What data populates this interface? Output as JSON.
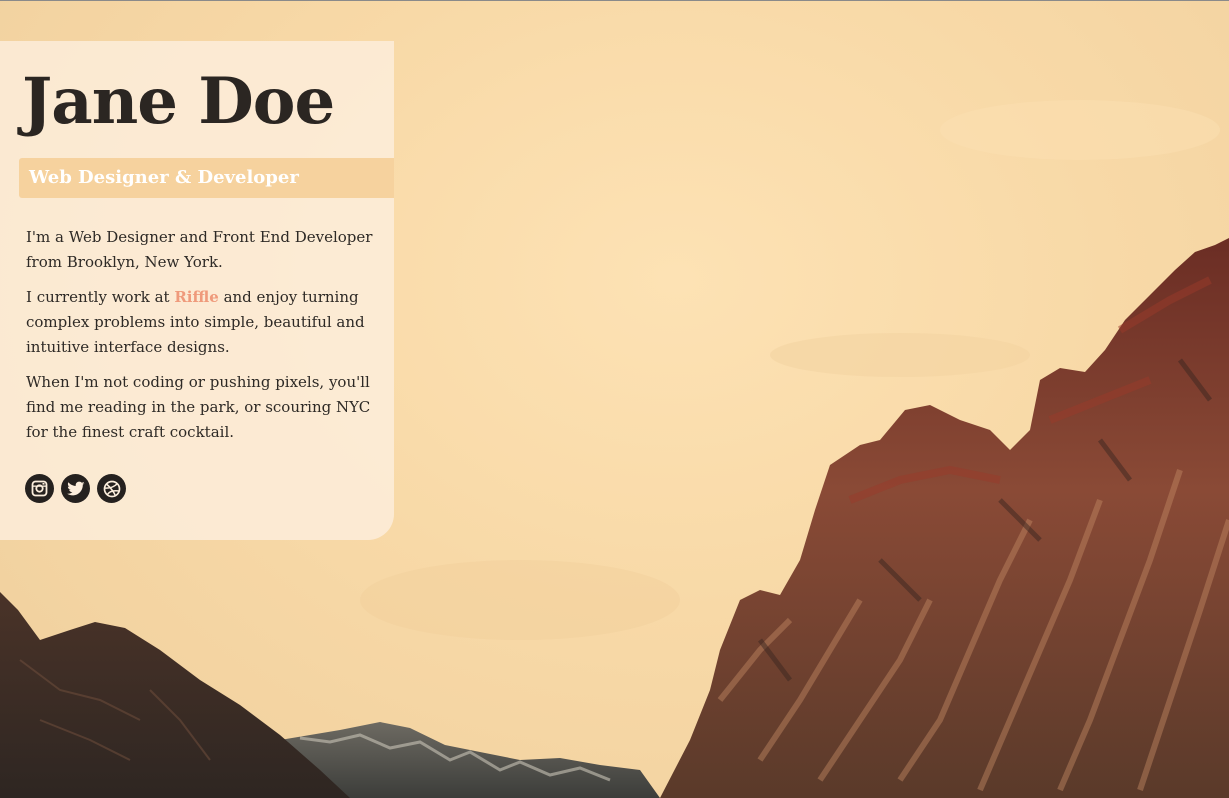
{
  "profile": {
    "name": "Jane Doe",
    "subtitle": "Web Designer & Developer"
  },
  "bio": {
    "p1": "I'm a Web Designer and Front End Developer from Brooklyn, New York.",
    "p2_before": "I currently work at ",
    "p2_link": "Riffle",
    "p2_after": " and enjoy turning complex problems into simple, beautiful and intuitive interface designs.",
    "p3": "When I'm not coding or pushing pixels, you'll find me reading in the park, or scouring NYC for the finest craft cocktail."
  },
  "social": [
    {
      "icon": "instagram-icon"
    },
    {
      "icon": "twitter-icon"
    },
    {
      "icon": "dribbble-icon"
    }
  ],
  "colors": {
    "sky": "#f8d9a7",
    "card": "#fceedd",
    "subtitle_band": "#f6d29e",
    "link": "#ef9a7b",
    "text": "#2e2a26",
    "icon": "#25211f"
  }
}
